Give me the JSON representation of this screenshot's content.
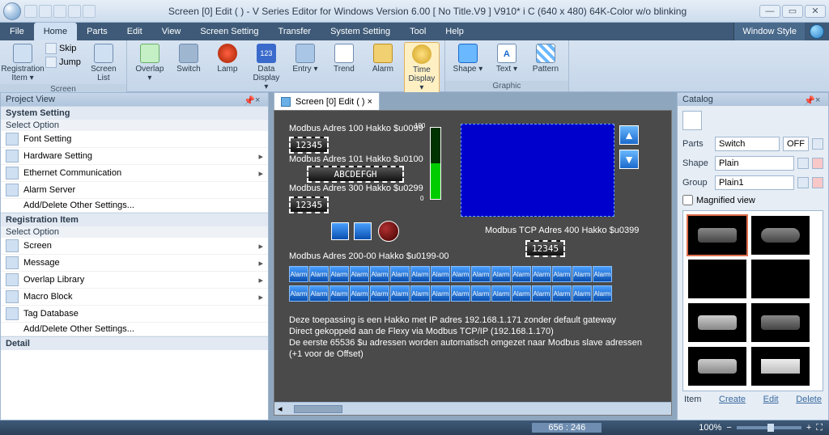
{
  "title": "Screen [0] Edit (            ) - V Series Editor for Windows Version 6.00 [ No Title.V9 ] V910* i C (640 x 480) 64K-Color w/o blinking",
  "menu": {
    "items": [
      "File",
      "Home",
      "Parts",
      "Edit",
      "View",
      "Screen Setting",
      "Transfer",
      "System Setting",
      "Tool",
      "Help"
    ],
    "active": 1,
    "window_style": "Window Style"
  },
  "ribbon": {
    "screen": {
      "name": "Screen",
      "reg_item": "Registration\nItem ▾",
      "skip": "Skip",
      "jump": "Jump",
      "screen_list": "Screen\nList"
    },
    "parts": {
      "name": "Parts",
      "items": [
        "Overlap ▾",
        "Switch",
        "Lamp",
        "Data\nDisplay ▾",
        "Entry ▾",
        "Trend",
        "Alarm",
        "Time\nDisplay ▾"
      ]
    },
    "graphic": {
      "name": "Graphic",
      "items": [
        "Shape ▾",
        "Text ▾",
        "Pattern"
      ]
    }
  },
  "project_view": {
    "title": "Project View",
    "system_setting": {
      "head": "System Setting",
      "sub": "Select Option",
      "items": [
        "Font Setting",
        "Hardware Setting",
        "Ethernet Communication",
        "Alarm Server",
        "Add/Delete Other Settings..."
      ]
    },
    "reg_item": {
      "head": "Registration Item",
      "sub": "Select Option",
      "items": [
        "Screen",
        "Message",
        "Overlap Library",
        "Macro Block",
        "Tag Database",
        "Add/Delete Other Settings..."
      ]
    },
    "detail": "Detail"
  },
  "doc_tab": "Screen [0] Edit (         )  ×",
  "canvas": {
    "l1": "Modbus Adres 100 Hakko $u0099",
    "v1": "12345",
    "l2": "Modbus Adres 101 Hakko $u0100",
    "v2": "ABCDEFGH",
    "l3": "Modbus Adres 300 Hakko $u0299",
    "v3": "12345",
    "l4": "Modbus Adres 200-00 Hakko $u0199-00",
    "l5": "Modbus TCP Adres 400 Hakko $u0399",
    "v5": "12345",
    "bar_top": "100",
    "bar_bot": "0",
    "alarm": "Alarm",
    "info1": "Deze toepassing is een Hakko met IP adres 192.168.1.171 zonder default gateway",
    "info2": "Direct gekoppeld aan de Flexy via Modbus TCP/IP (192.168.1.170)",
    "info3": "De eerste 65536 $u adressen worden automatisch omgezet naar Modbus slave adressen",
    "info4": "(+1 voor de Offset)"
  },
  "catalog": {
    "title": "Catalog",
    "parts_label": "Parts",
    "parts_value": "Switch",
    "off": "OFF",
    "shape_label": "Shape",
    "shape_value": "Plain",
    "group_label": "Group",
    "group_value": "Plain1",
    "magnified": "Magnified view",
    "item": "Item",
    "create": "Create",
    "edit": "Edit",
    "delete": "Delete"
  },
  "status": {
    "coords": "656 : 246",
    "zoom": "100%"
  }
}
